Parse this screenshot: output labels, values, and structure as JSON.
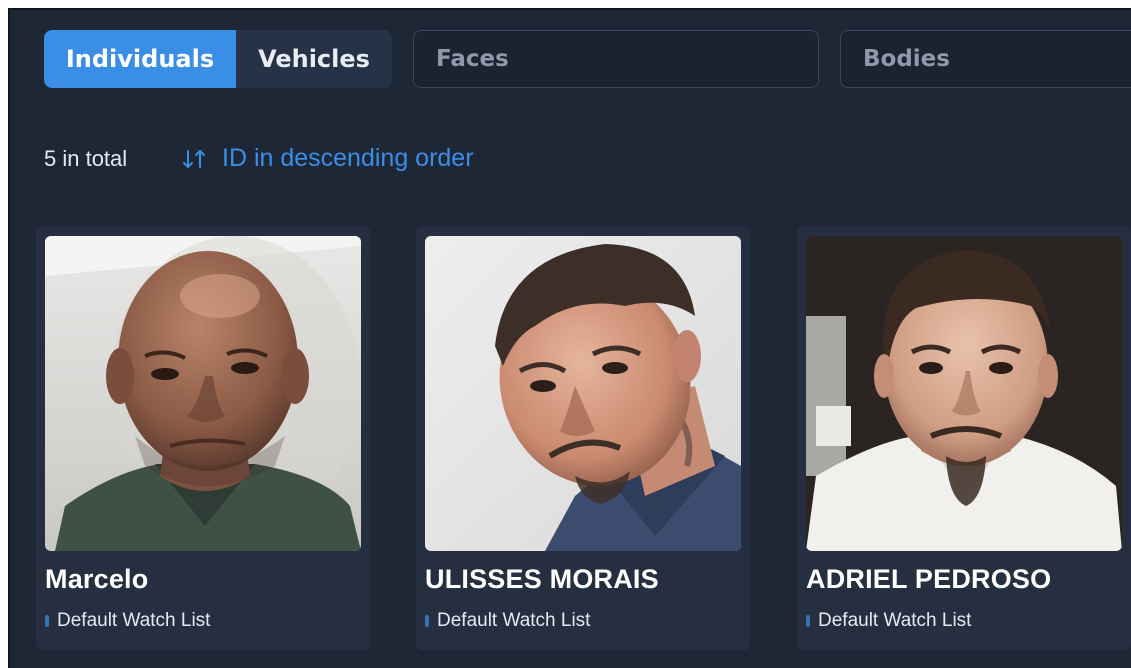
{
  "toggle": {
    "individuals_label": "Individuals",
    "vehicles_label": "Vehicles"
  },
  "search": {
    "faces_placeholder": "Faces",
    "bodies_placeholder": "Bodies"
  },
  "summary": {
    "total_label": "5 in total",
    "sort_label": "ID in descending order"
  },
  "cards": [
    {
      "name": "Marcelo",
      "watch_list": "Default Watch List"
    },
    {
      "name": "ULISSES MORAIS",
      "watch_list": "Default Watch List"
    },
    {
      "name": "ADRIEL PEDROSO",
      "watch_list": "Default Watch List"
    }
  ],
  "colors": {
    "accent": "#3a8ee6",
    "background": "#1e2736",
    "card": "#252f40"
  }
}
